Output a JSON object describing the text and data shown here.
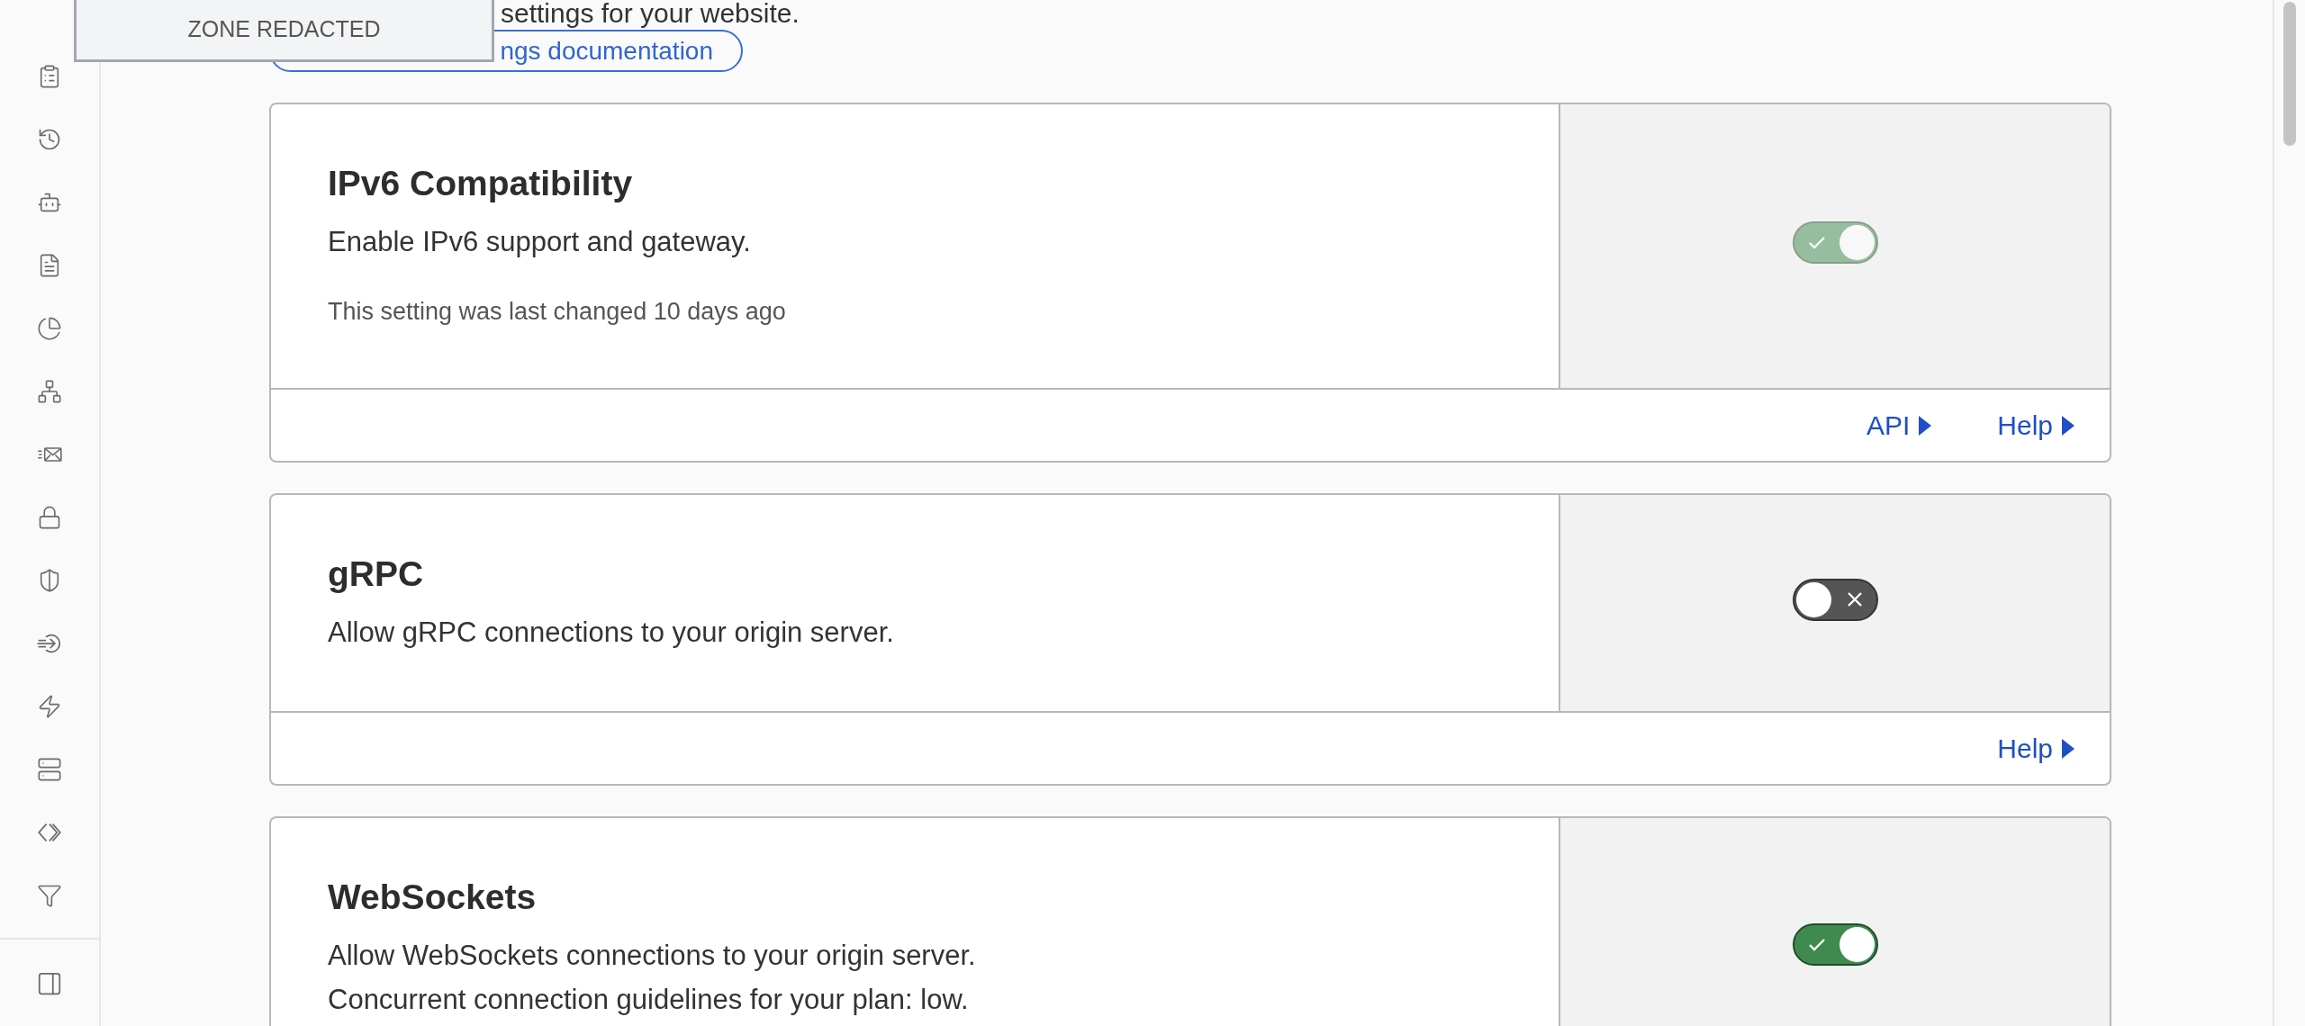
{
  "redaction": {
    "label": "ZONE REDACTED"
  },
  "intro": {
    "text": "settings for your website.",
    "docs_button": "ngs documentation"
  },
  "settings": [
    {
      "title": "IPv6 Compatibility",
      "description": [
        "Enable IPv6 support and gateway."
      ],
      "last_changed": "This setting was last changed 10 days ago",
      "on": true,
      "disabled": true,
      "links": [
        {
          "label": "API"
        },
        {
          "label": "Help"
        }
      ]
    },
    {
      "title": "gRPC",
      "description": [
        "Allow gRPC connections to your origin server."
      ],
      "on": false,
      "disabled": false,
      "links": [
        {
          "label": "Help"
        }
      ]
    },
    {
      "title": "WebSockets",
      "description": [
        "Allow WebSockets connections to your origin server.",
        "Concurrent connection guidelines for your plan: low."
      ],
      "on": true,
      "disabled": false
    }
  ]
}
